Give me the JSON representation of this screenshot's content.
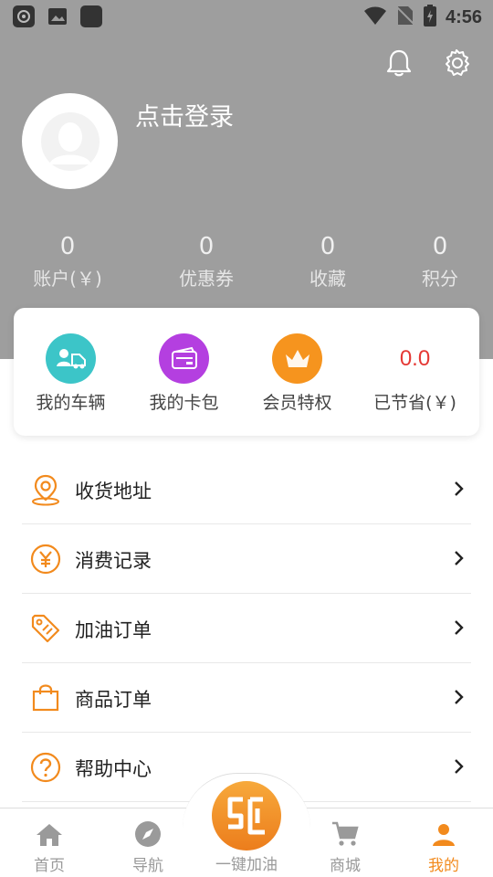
{
  "status_bar": {
    "time": "4:56"
  },
  "profile": {
    "login_text": "点击登录"
  },
  "stats": [
    {
      "value": "0",
      "label": "账户(￥)"
    },
    {
      "value": "0",
      "label": "优惠券"
    },
    {
      "value": "0",
      "label": "收藏"
    },
    {
      "value": "0",
      "label": "积分"
    }
  ],
  "quick": {
    "vehicles": "我的车辆",
    "wallet": "我的卡包",
    "vip": "会员特权",
    "saved_label": "已节省(￥)",
    "saved_value": "0.0"
  },
  "menu": [
    {
      "label": "收货地址"
    },
    {
      "label": "消费记录"
    },
    {
      "label": "加油订单"
    },
    {
      "label": "商品订单"
    },
    {
      "label": "帮助中心"
    }
  ],
  "tabs": {
    "home": "首页",
    "nav": "导航",
    "refuel": "一键加油",
    "mall": "商城",
    "mine": "我的"
  },
  "colors": {
    "accent": "#f28a1d",
    "header_bg": "#9e9e9e",
    "price_red": "#e53935"
  }
}
